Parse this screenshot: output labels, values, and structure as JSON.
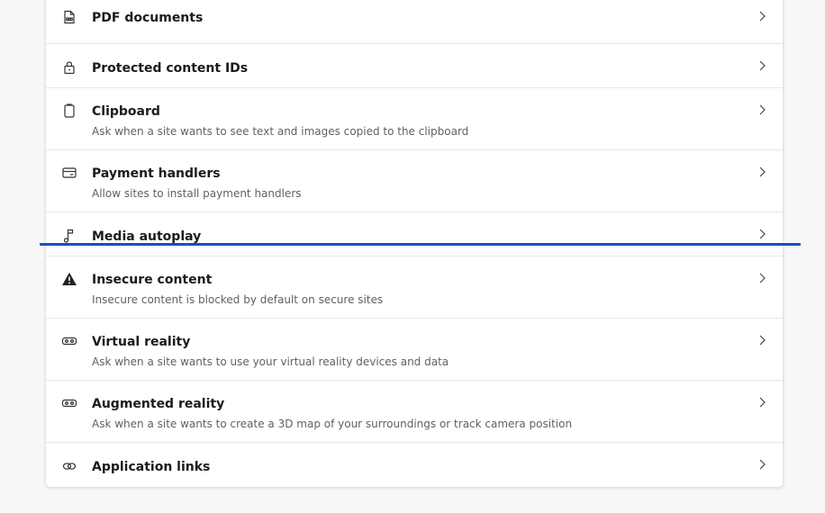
{
  "items": [
    {
      "title": "PDF documents",
      "desc": "",
      "icon": "pdf-document-icon"
    },
    {
      "title": "Protected content IDs",
      "desc": "",
      "icon": "lock-icon"
    },
    {
      "title": "Clipboard",
      "desc": "Ask when a site wants to see text and images copied to the clipboard",
      "icon": "clipboard-icon"
    },
    {
      "title": "Payment handlers",
      "desc": "Allow sites to install payment handlers",
      "icon": "card-icon"
    },
    {
      "title": "Media autoplay",
      "desc": "",
      "icon": "music-note-icon"
    },
    {
      "title": "Insecure content",
      "desc": "Insecure content is blocked by default on secure sites",
      "icon": "warning-icon"
    },
    {
      "title": "Virtual reality",
      "desc": "Ask when a site wants to use your virtual reality devices and data",
      "icon": "vr-headset-icon"
    },
    {
      "title": "Augmented reality",
      "desc": "Ask when a site wants to create a 3D map of your surroundings or track camera position",
      "icon": "ar-headset-icon"
    },
    {
      "title": "Application links",
      "desc": "",
      "icon": "link-icon"
    }
  ],
  "colors": {
    "accent": "#1550c9",
    "background": "#f7f7f7",
    "card": "#ffffff",
    "title": "#1b1b1b",
    "description": "#616161"
  }
}
